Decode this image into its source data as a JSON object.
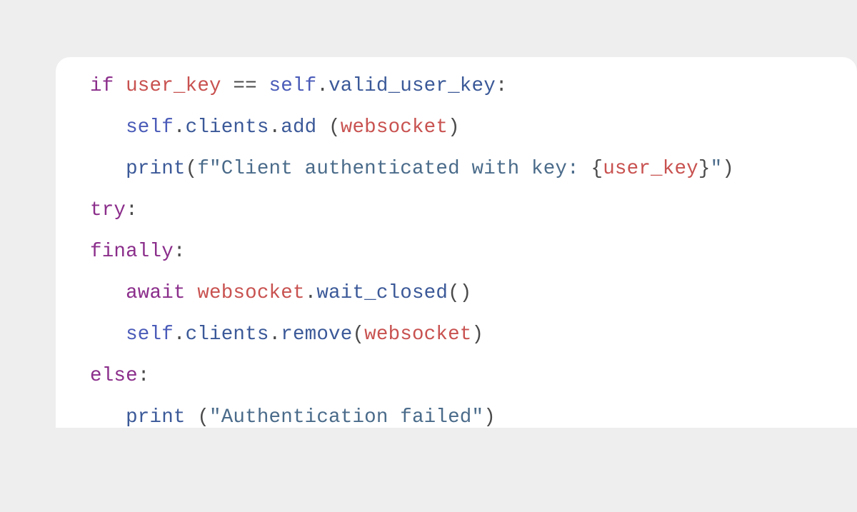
{
  "code": {
    "lines": [
      {
        "indent": 0,
        "tokens": [
          {
            "t": "if ",
            "cls": "tok-kw"
          },
          {
            "t": "user_key",
            "cls": "tok-var"
          },
          {
            "t": " == ",
            "cls": "tok-op"
          },
          {
            "t": "self",
            "cls": "tok-self"
          },
          {
            "t": ".",
            "cls": "tok-punct"
          },
          {
            "t": "valid_user_key",
            "cls": "tok-prop"
          },
          {
            "t": ":",
            "cls": "tok-punct"
          }
        ]
      },
      {
        "indent": 1,
        "tokens": [
          {
            "t": "self",
            "cls": "tok-self"
          },
          {
            "t": ".",
            "cls": "tok-punct"
          },
          {
            "t": "clients",
            "cls": "tok-prop"
          },
          {
            "t": ".",
            "cls": "tok-punct"
          },
          {
            "t": "add",
            "cls": "tok-prop"
          },
          {
            "t": " (",
            "cls": "tok-punct"
          },
          {
            "t": "websocket",
            "cls": "tok-var"
          },
          {
            "t": ")",
            "cls": "tok-punct"
          }
        ]
      },
      {
        "indent": 1,
        "tokens": [
          {
            "t": "print",
            "cls": "tok-func"
          },
          {
            "t": "(",
            "cls": "tok-punct"
          },
          {
            "t": "f\"Client authenticated with key: ",
            "cls": "tok-fstr"
          },
          {
            "t": "{",
            "cls": "tok-punct"
          },
          {
            "t": "user_key",
            "cls": "tok-var"
          },
          {
            "t": "}",
            "cls": "tok-punct"
          },
          {
            "t": "\"",
            "cls": "tok-fstr"
          },
          {
            "t": ")",
            "cls": "tok-punct"
          }
        ]
      },
      {
        "indent": 0,
        "tokens": [
          {
            "t": "try",
            "cls": "tok-kw"
          },
          {
            "t": ":",
            "cls": "tok-punct"
          }
        ]
      },
      {
        "indent": 0,
        "tokens": [
          {
            "t": "finally",
            "cls": "tok-kw"
          },
          {
            "t": ":",
            "cls": "tok-punct"
          }
        ]
      },
      {
        "indent": 1,
        "tokens": [
          {
            "t": "await ",
            "cls": "tok-kw"
          },
          {
            "t": "websocket",
            "cls": "tok-var"
          },
          {
            "t": ".",
            "cls": "tok-punct"
          },
          {
            "t": "wait_closed",
            "cls": "tok-func"
          },
          {
            "t": "()",
            "cls": "tok-punct"
          }
        ]
      },
      {
        "indent": 1,
        "tokens": [
          {
            "t": "self",
            "cls": "tok-self"
          },
          {
            "t": ".",
            "cls": "tok-punct"
          },
          {
            "t": "clients",
            "cls": "tok-prop"
          },
          {
            "t": ".",
            "cls": "tok-punct"
          },
          {
            "t": "remove",
            "cls": "tok-func"
          },
          {
            "t": "(",
            "cls": "tok-punct"
          },
          {
            "t": "websocket",
            "cls": "tok-var"
          },
          {
            "t": ")",
            "cls": "tok-punct"
          }
        ]
      },
      {
        "indent": 0,
        "tokens": [
          {
            "t": "else",
            "cls": "tok-kw"
          },
          {
            "t": ":",
            "cls": "tok-punct"
          }
        ]
      },
      {
        "indent": 1,
        "tokens": [
          {
            "t": "print ",
            "cls": "tok-func"
          },
          {
            "t": "(",
            "cls": "tok-punct"
          },
          {
            "t": "\"Authentication failed\"",
            "cls": "tok-str"
          },
          {
            "t": ")",
            "cls": "tok-punct"
          }
        ]
      }
    ],
    "indent_unit": "   "
  }
}
